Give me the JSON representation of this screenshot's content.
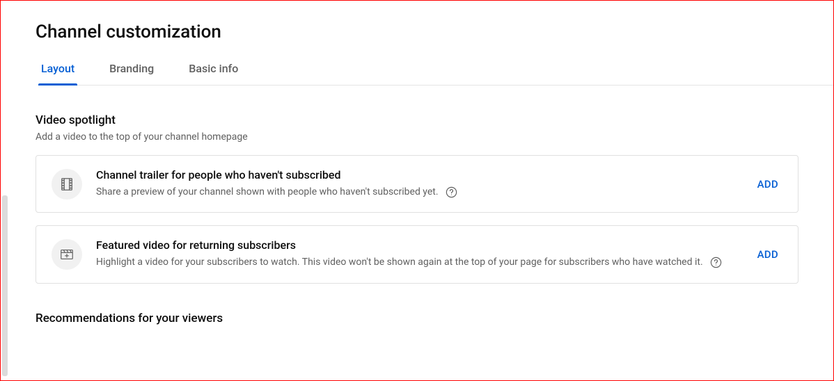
{
  "page_title": "Channel customization",
  "tabs": [
    {
      "label": "Layout",
      "active": true
    },
    {
      "label": "Branding",
      "active": false
    },
    {
      "label": "Basic info",
      "active": false
    }
  ],
  "video_spotlight": {
    "title": "Video spotlight",
    "description": "Add a video to the top of your channel homepage",
    "cards": [
      {
        "icon": "film-strip",
        "title": "Channel trailer for people who haven't subscribed",
        "description": "Share a preview of your channel shown with people who haven't subscribed yet.",
        "action_label": "ADD"
      },
      {
        "icon": "clapperboard",
        "title": "Featured video for returning subscribers",
        "description": "Highlight a video for your subscribers to watch. This video won't be shown again at the top of your page for subscribers who have watched it.",
        "action_label": "ADD"
      }
    ]
  },
  "recommendations": {
    "title": "Recommendations for your viewers"
  }
}
